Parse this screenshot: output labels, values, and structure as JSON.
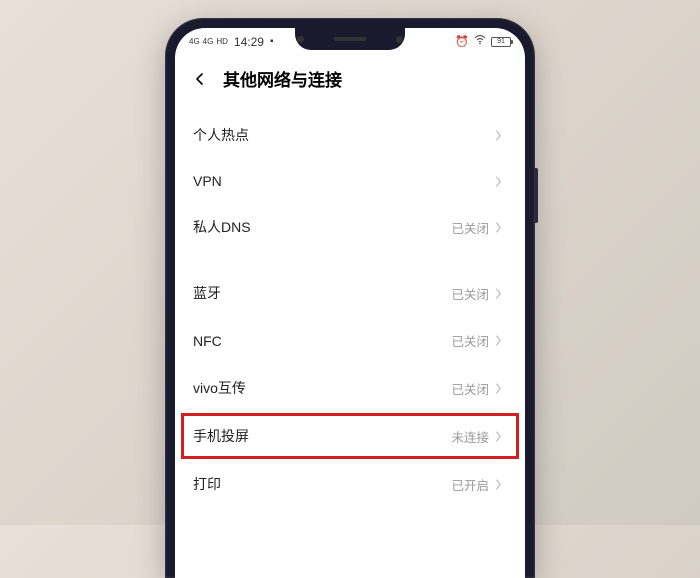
{
  "status": {
    "signal_left": "4G",
    "signal_right": "4G",
    "hd": "HD",
    "time": "14:29",
    "battery": "91"
  },
  "header": {
    "title": "其他网络与连接"
  },
  "groups": [
    {
      "items": [
        {
          "label": "个人热点",
          "value": ""
        },
        {
          "label": "VPN",
          "value": ""
        },
        {
          "label": "私人DNS",
          "value": "已关闭"
        }
      ]
    },
    {
      "items": [
        {
          "label": "蓝牙",
          "value": "已关闭"
        },
        {
          "label": "NFC",
          "value": "已关闭"
        },
        {
          "label": "vivo互传",
          "value": "已关闭"
        },
        {
          "label": "手机投屏",
          "value": "未连接",
          "highlight": true
        },
        {
          "label": "打印",
          "value": "已开启"
        }
      ]
    }
  ]
}
